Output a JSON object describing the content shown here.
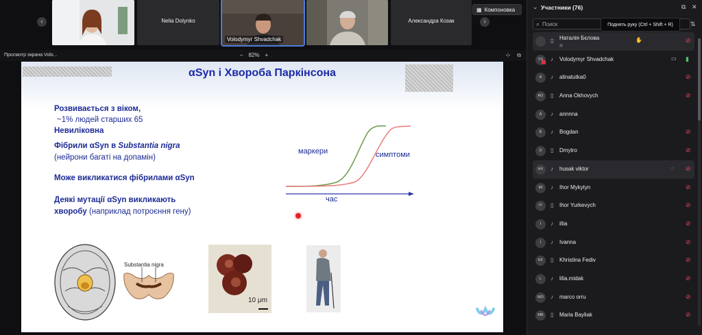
{
  "video_strip": {
    "tiles": [
      {
        "name": "",
        "label": ""
      },
      {
        "name": "Nelia Dolynko",
        "label": ""
      },
      {
        "name": "",
        "label": "Volodymyr Shvadchak"
      },
      {
        "name": "",
        "label": ""
      },
      {
        "name": "Александра Козак",
        "label": ""
      }
    ],
    "layout_button": "Компоновка"
  },
  "share_bar": {
    "title": "Просмотр экрана Volo...",
    "zoom_minus": "–",
    "zoom_value": "82%",
    "zoom_plus": "+"
  },
  "slide": {
    "title": "αSyn і Хвороба Паркінсона",
    "lines": {
      "l1": "Розвивається з віком,",
      "l2": "~1% людей старших 65",
      "l3": "Невиліковна",
      "l4a": "Фібрили αSyn в ",
      "l4b": "Substantia nigra",
      "l5": "(нейрони багаті на допамін)",
      "l6": "Може викликатися фібрилами αSyn",
      "l7": "Деякі мутації αSyn викликають",
      "l8a": "хворобу",
      "l8b": " (наприклад потроєння гену)"
    },
    "curve_labels": {
      "markers": "маркери",
      "symptoms": "симптоми",
      "time": "час"
    },
    "substantia_label": "Substantia nigra",
    "scale_label": "10 μm",
    "colors": {
      "markers_curve": "#6a9a4a",
      "symptoms_curve": "#e97a7a",
      "axis": "#2b35a8",
      "text": "#1b2a94"
    }
  },
  "participants": {
    "title": "Участники (76)",
    "search_placeholder": "Поиск",
    "tooltip": "Поднять руку (Ctrl + Shift + R)",
    "rows": [
      {
        "initials": "",
        "name": "Наталія Бєлова",
        "sub": "Я",
        "mic": "off",
        "extra": "hand-icon",
        "highlight": true
      },
      {
        "initials": "VS",
        "name": "Volodymyr Shvadchak",
        "sub": "",
        "mic": "on",
        "extra": "camera-icon",
        "highlight": false
      },
      {
        "initials": "A",
        "name": "alinatutka0",
        "sub": "",
        "mic": "off",
        "extra": "",
        "highlight": false
      },
      {
        "initials": "AO",
        "name": "Anna Okhovych",
        "sub": "",
        "mic": "off",
        "extra": "",
        "highlight": false
      },
      {
        "initials": "A",
        "name": "annnna",
        "sub": "",
        "mic": "",
        "extra": "",
        "highlight": false
      },
      {
        "initials": "B",
        "name": "Bogdan",
        "sub": "",
        "mic": "off",
        "extra": "",
        "highlight": false
      },
      {
        "initials": "D",
        "name": "Dmytro",
        "sub": "",
        "mic": "off",
        "extra": "",
        "highlight": false
      },
      {
        "initials": "HV",
        "name": "husak viktor",
        "sub": "",
        "mic": "off",
        "extra": "chat-icon",
        "highlight": true
      },
      {
        "initials": "IM",
        "name": "Ihor Mykytyn",
        "sub": "",
        "mic": "off",
        "extra": "",
        "highlight": false
      },
      {
        "initials": "IY",
        "name": "Ihor Yurkevych",
        "sub": "",
        "mic": "off",
        "extra": "",
        "highlight": false
      },
      {
        "initials": "I",
        "name": "illia",
        "sub": "",
        "mic": "off",
        "extra": "",
        "highlight": false
      },
      {
        "initials": "I",
        "name": "Ivanna",
        "sub": "",
        "mic": "off",
        "extra": "",
        "highlight": false
      },
      {
        "initials": "KF",
        "name": "Khristina Fediv",
        "sub": "",
        "mic": "off",
        "extra": "",
        "highlight": false
      },
      {
        "initials": "L",
        "name": "lilia.midak",
        "sub": "",
        "mic": "off",
        "extra": "",
        "highlight": false
      },
      {
        "initials": "MO",
        "name": "marco orru",
        "sub": "",
        "mic": "off",
        "extra": "",
        "highlight": false
      },
      {
        "initials": "MB",
        "name": "Maria Bayliak",
        "sub": "",
        "mic": "off",
        "extra": "",
        "highlight": false
      }
    ]
  }
}
